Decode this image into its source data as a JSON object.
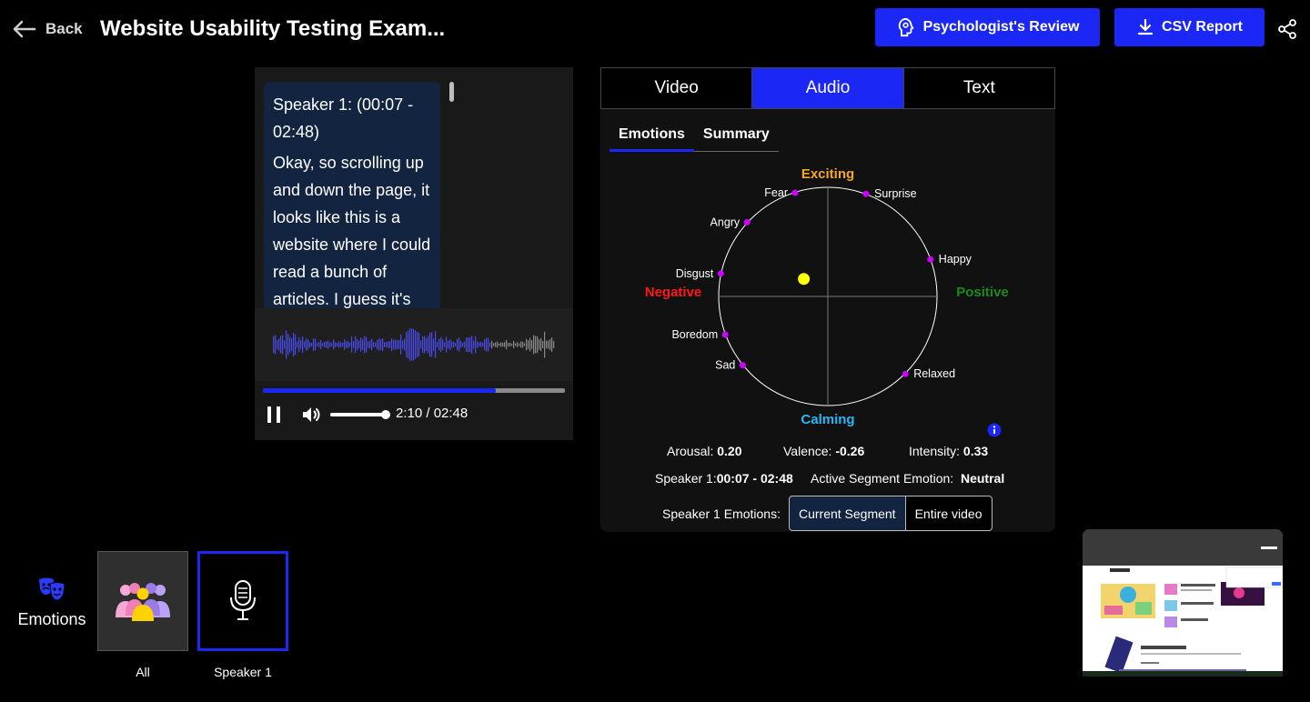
{
  "header": {
    "back_label": "Back",
    "title": "Website Usability Testing Exam...",
    "psych_review_label": "Psychologist's Review",
    "csv_report_label": "CSV Report"
  },
  "transcript": {
    "speaker": "Speaker 1: (00:07 - 02:48)",
    "text": "Okay, so scrolling up and down the page, it looks like this is a website where I could read a bunch of articles. I guess it's"
  },
  "audio": {
    "progress": 0.77,
    "volume": 0.9,
    "time": "2:10 / 02:48"
  },
  "tabs": [
    {
      "label": "Video",
      "active": false
    },
    {
      "label": "Audio",
      "active": true
    },
    {
      "label": "Text",
      "active": false
    }
  ],
  "subtabs": [
    {
      "label": "Emotions",
      "active": true
    },
    {
      "label": "Summary",
      "active": false
    }
  ],
  "chart_data": {
    "type": "scatter",
    "axes": {
      "top": "Exciting",
      "bottom": "Calming",
      "left": "Negative",
      "right": "Positive"
    },
    "axis_colors": {
      "top": "#f5a623",
      "bottom": "#29b6f6",
      "left": "#ff1a1a",
      "right": "#1a8a1a"
    },
    "xlim": [
      -1,
      1
    ],
    "ylim": [
      -1,
      1
    ],
    "emotions": [
      {
        "label": "Fear",
        "x": -0.3,
        "y": 0.95
      },
      {
        "label": "Surprise",
        "x": 0.35,
        "y": 0.94
      },
      {
        "label": "Angry",
        "x": -0.74,
        "y": 0.68
      },
      {
        "label": "Happy",
        "x": 0.94,
        "y": 0.34
      },
      {
        "label": "Disgust",
        "x": -0.98,
        "y": 0.21
      },
      {
        "label": "Boredom",
        "x": -0.94,
        "y": -0.35
      },
      {
        "label": "Sad",
        "x": -0.78,
        "y": -0.63
      },
      {
        "label": "Relaxed",
        "x": 0.71,
        "y": -0.71
      }
    ],
    "point": {
      "x": -0.22,
      "y": 0.16,
      "color": "#ffff00"
    },
    "marker_color": "#cc00ff"
  },
  "metrics": {
    "arousal_label": "Arousal:",
    "arousal": "0.20",
    "valence_label": "Valence:",
    "valence": "-0.26",
    "intensity_label": "Intensity:",
    "intensity": "0.33",
    "speaker_label": "Speaker 1:",
    "speaker_time": "00:07 - 02:48",
    "active_label": "Active Segment Emotion:",
    "active_emotion": "Neutral"
  },
  "segment": {
    "label": "Speaker 1 Emotions:",
    "current": "Current Segment",
    "entire": "Entire video"
  },
  "bottom": {
    "emotions_label": "Emotions",
    "tile_all": "All",
    "tile_speaker": "Speaker 1"
  },
  "colors": {
    "accent": "#1b27f5",
    "transcript_bg": "#12243f"
  }
}
